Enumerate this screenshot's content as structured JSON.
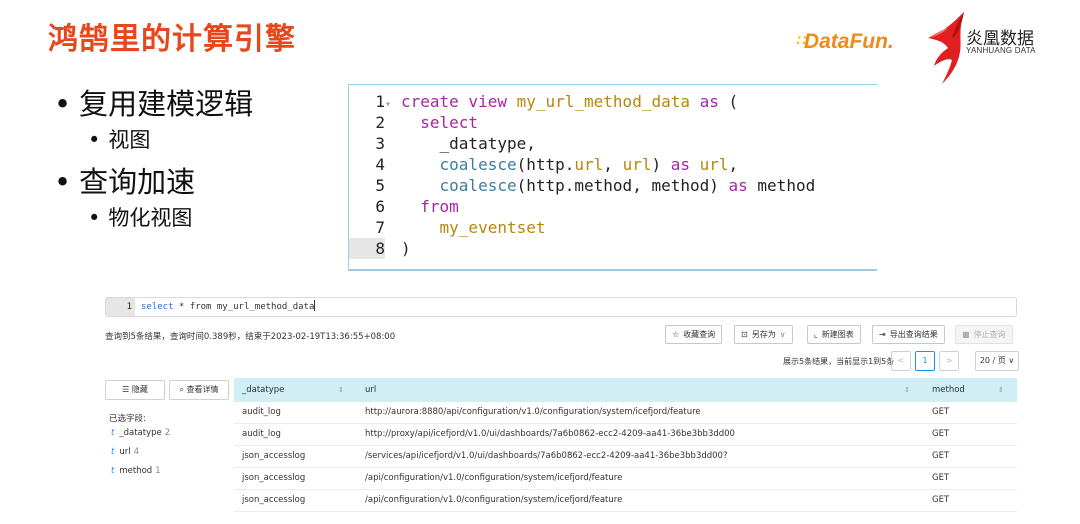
{
  "slide": {
    "title": "鸿鹄里的计算引擎",
    "brand_datafun": "DataFun.",
    "brand_yh_name": "炎凰数据",
    "brand_yh_sub": "YANHUANG DATA",
    "bullets": [
      {
        "text": "复用建模逻辑",
        "sub": [
          "视图"
        ]
      },
      {
        "text": "查询加速",
        "sub": [
          "物化视图"
        ]
      }
    ],
    "colors": {
      "title": "#e8471c",
      "datafun": "#f08a1c",
      "yh_red": "#e02020"
    }
  },
  "code": {
    "lines": [
      {
        "n": "1",
        "tokens": [
          [
            "kw",
            "create view "
          ],
          [
            "id",
            "my_url_method_data"
          ],
          [
            "kw",
            " as "
          ],
          [
            "pl",
            "("
          ]
        ]
      },
      {
        "n": "2",
        "tokens": [
          [
            "pl",
            "  "
          ],
          [
            "kw",
            "select"
          ]
        ]
      },
      {
        "n": "3",
        "tokens": [
          [
            "pl",
            "    _datatype,"
          ]
        ]
      },
      {
        "n": "4",
        "tokens": [
          [
            "pl",
            "    "
          ],
          [
            "fn",
            "coalesce"
          ],
          [
            "pl",
            "(http."
          ],
          [
            "id",
            "url"
          ],
          [
            "pl",
            ", "
          ],
          [
            "id",
            "url"
          ],
          [
            "pl",
            ") "
          ],
          [
            "kw",
            "as"
          ],
          [
            "pl",
            " "
          ],
          [
            "id",
            "url"
          ],
          [
            "pl",
            ","
          ]
        ]
      },
      {
        "n": "5",
        "tokens": [
          [
            "pl",
            "    "
          ],
          [
            "fn",
            "coalesce"
          ],
          [
            "pl",
            "(http.method, method) "
          ],
          [
            "kw",
            "as"
          ],
          [
            "pl",
            " method"
          ]
        ]
      },
      {
        "n": "6",
        "tokens": [
          [
            "pl",
            "  "
          ],
          [
            "kw",
            "from"
          ]
        ]
      },
      {
        "n": "7",
        "tokens": [
          [
            "pl",
            "    "
          ],
          [
            "id",
            "my_eventset"
          ]
        ]
      },
      {
        "n": "8",
        "tokens": [
          [
            "pl",
            ")"
          ]
        ]
      }
    ],
    "active_line": "8"
  },
  "query_ui": {
    "editor": {
      "line": "1",
      "kw": "select",
      "rest": " * from my_url_method_data"
    },
    "status": "查询到5条结果，查询时间0.389秒，结束于2023-02-19T13:36:55+08:00",
    "buttons": {
      "save": "收藏查询",
      "save_as": "另存为",
      "new_chart": "新建图表",
      "export": "导出查询结果",
      "stop": "停止查询"
    },
    "page_info": "展示5条结果，当前显示1到5条",
    "current_page": "1",
    "page_size": "20 / 页",
    "hide_btn": "隐藏",
    "detail_btn": "查看详情",
    "fields_title": "已选字段:",
    "fields": [
      {
        "name": "_datatype",
        "count": "2"
      },
      {
        "name": "url",
        "count": "4"
      },
      {
        "name": "method",
        "count": "1"
      }
    ],
    "columns": [
      "_datatype",
      "url",
      "method"
    ],
    "rows": [
      [
        "audit_log",
        "http://aurora:8880/api/configuration/v1.0/configuration/system/icefjord/feature",
        "GET"
      ],
      [
        "audit_log",
        "http://proxy/api/icefjord/v1.0/ui/dashboards/7a6b0862-ecc2-4209-aa41-36be3bb3dd00",
        "GET"
      ],
      [
        "json_accesslog",
        "/services/api/icefjord/v1.0/ui/dashboards/7a6b0862-ecc2-4209-aa41-36be3bb3dd00?",
        "GET"
      ],
      [
        "json_accesslog",
        "/api/configuration/v1.0/configuration/system/icefjord/feature",
        "GET"
      ],
      [
        "json_accesslog",
        "/api/configuration/v1.0/configuration/system/icefjord/feature",
        "GET"
      ]
    ],
    "colors": {
      "header_bg": "#d0eef4",
      "accent": "#1890ff"
    }
  }
}
